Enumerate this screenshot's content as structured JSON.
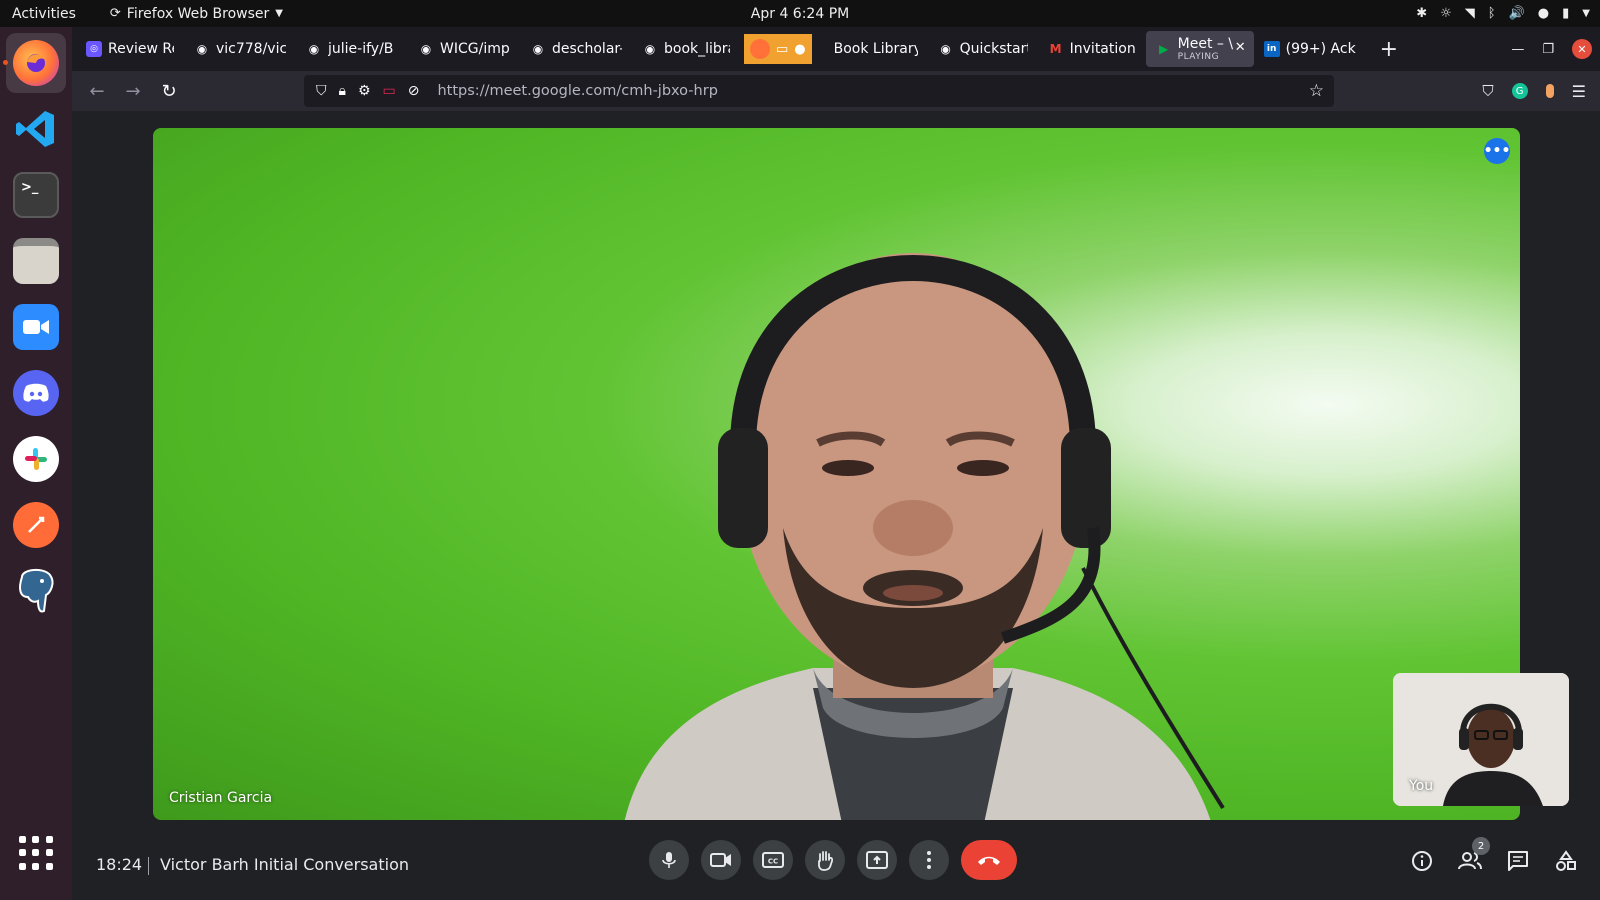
{
  "topbar": {
    "activities": "Activities",
    "app_name": "Firefox Web Browser",
    "clock": "Apr 4  6:24 PM"
  },
  "dock": {
    "apps": [
      "firefox-icon",
      "vscode-icon",
      "terminal-icon",
      "files-icon",
      "zoom-icon",
      "discord-icon",
      "slack-icon",
      "postman-icon",
      "postgresql-icon"
    ]
  },
  "browser": {
    "tabs": [
      {
        "label": "Review Re",
        "icon": "lens-icon"
      },
      {
        "label": "vic778/vic",
        "icon": "github-icon"
      },
      {
        "label": "julie-ify/B",
        "icon": "github-icon"
      },
      {
        "label": "WICG/imp",
        "icon": "github-icon"
      },
      {
        "label": "descholar-",
        "icon": "github-icon"
      },
      {
        "label": "book_libra",
        "icon": "github-icon"
      },
      {
        "label": "Book Library",
        "icon": "none"
      },
      {
        "label": "Quickstart",
        "icon": "github-icon"
      },
      {
        "label": "Invitation:",
        "icon": "gmail-icon"
      },
      {
        "label": "Meet – \\",
        "sub": "PLAYING",
        "icon": "meet-icon"
      },
      {
        "label": "(99+) Ackl",
        "icon": "linkedin-icon"
      }
    ],
    "url": "https://meet.google.com/cmh-jbxo-hrp"
  },
  "meet": {
    "participant_name": "Cristian Garcia",
    "self_label": "You",
    "time": "18:24",
    "title": "Victor Barh Initial Conversation",
    "people_count": "2"
  },
  "colors": {
    "end_call": "#ea4335",
    "accent_blue": "#1a73e8",
    "dock_bg": "#2e1f2b"
  }
}
